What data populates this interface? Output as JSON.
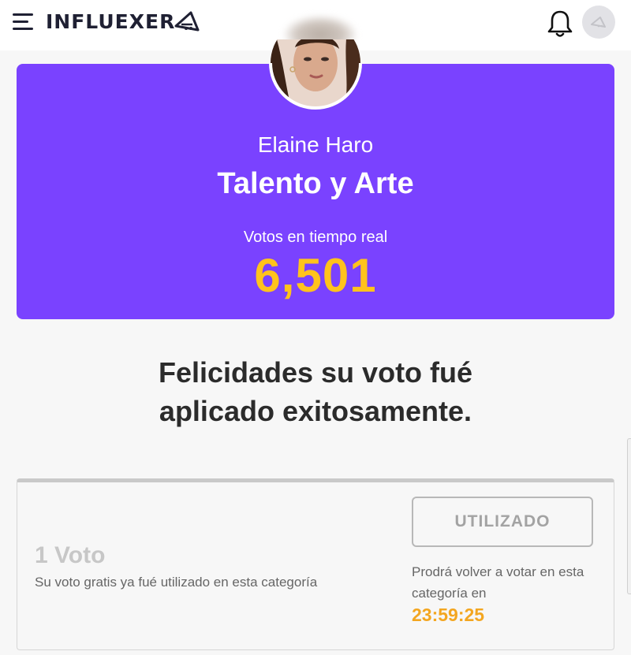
{
  "header": {
    "logo_text": "INFLUEXER",
    "icons": {
      "menu": "hamburger-menu-icon",
      "bell": "notification-bell-icon",
      "avatar": "user-avatar-icon"
    }
  },
  "profile": {
    "name": "Elaine Haro",
    "category": "Talento y Arte",
    "votes_label": "Votos en tiempo real",
    "votes_count": "6,501"
  },
  "message": {
    "line1": "Felicidades su voto fué",
    "line2": "aplicado exitosamente."
  },
  "vote_card": {
    "title": "1 Voto",
    "description": "Su voto gratis ya fué utilizado en esta categoría",
    "button_label": "UTILIZADO",
    "retry_text": "Prodrá volver a votar en esta categoría en",
    "countdown": "23:59:25"
  },
  "colors": {
    "hero_bg": "#7a42ff",
    "votes_accent": "#ffc31c",
    "timer": "#f3a620",
    "logo_dark": "#1f2033"
  }
}
